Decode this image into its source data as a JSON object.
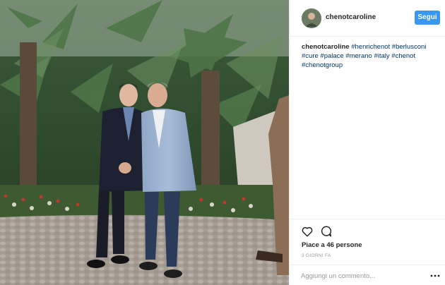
{
  "post": {
    "username": "chenotcaroline",
    "follow_label": "Segui",
    "caption": {
      "author": "chenotcaroline",
      "hashtags": [
        "#henrichenot",
        "#berlusconi",
        "#cure",
        "#palace",
        "#merano",
        "#italy",
        "#chenot",
        "#chenotgroup"
      ]
    },
    "likes_text": "Piace a 46 persone",
    "timestamp": "3 GIORNI FA",
    "comment_placeholder": "Aggiungi un commento..."
  },
  "icons": {
    "like": "heart-icon",
    "comment": "comment-icon",
    "more": "more-options-icon"
  },
  "colors": {
    "follow_button": "#3897f0",
    "hashtag": "#003569",
    "muted_text": "#999999",
    "border": "#efefef"
  }
}
